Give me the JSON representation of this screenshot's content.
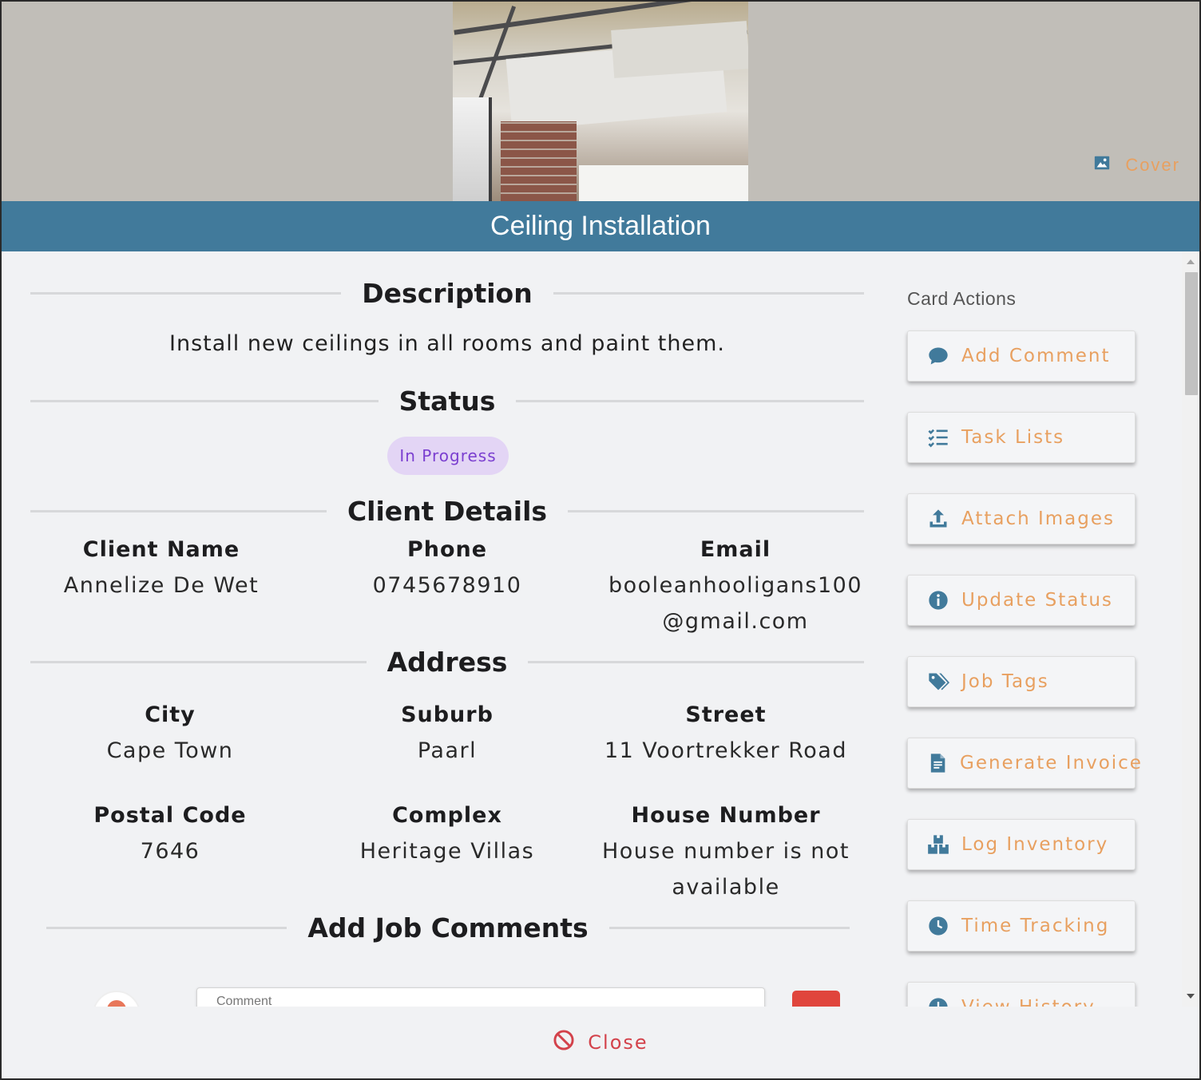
{
  "cover": {
    "button_label": "Cover",
    "button_icon": "image-icon"
  },
  "title": "Ceiling Installation",
  "sections": {
    "description": "Description",
    "status": "Status",
    "client_details": "Client Details",
    "address": "Address",
    "add_comments": "Add Job Comments"
  },
  "description_text": "Install new ceilings in all rooms and paint them.",
  "status_badge": "In Progress",
  "client": {
    "name_label": "Client Name",
    "name_value": "Annelize De Wet",
    "phone_label": "Phone",
    "phone_value": "0745678910",
    "email_label": "Email",
    "email_value_1": "booleanhooligans100",
    "email_value_2": "@gmail.com"
  },
  "address": {
    "city_label": "City",
    "city_value": "Cape Town",
    "suburb_label": "Suburb",
    "suburb_value": "Paarl",
    "street_label": "Street",
    "street_value": "11 Voortrekker Road",
    "postal_label": "Postal Code",
    "postal_value": "7646",
    "complex_label": "Complex",
    "complex_value": "Heritage Villas",
    "house_label": "House Number",
    "house_value_1": "House number is not",
    "house_value_2": "available"
  },
  "comment": {
    "placeholder": "Comment"
  },
  "card_actions": {
    "title": "Card Actions",
    "items": [
      {
        "label": "Add Comment",
        "icon": "comment-icon"
      },
      {
        "label": "Task Lists",
        "icon": "checklist-icon"
      },
      {
        "label": "Attach Images",
        "icon": "upload-icon"
      },
      {
        "label": "Update Status",
        "icon": "info-icon"
      },
      {
        "label": "Job Tags",
        "icon": "tags-icon"
      },
      {
        "label": "Generate Invoice",
        "icon": "invoice-icon"
      },
      {
        "label": "Log Inventory",
        "icon": "boxes-icon"
      },
      {
        "label": "Time Tracking",
        "icon": "clock-icon"
      },
      {
        "label": "View History",
        "icon": "history-icon"
      }
    ]
  },
  "footer": {
    "close_label": "Close"
  },
  "colors": {
    "title_bar": "#417a9b",
    "action_text": "#e8a060",
    "action_icon": "#417a9b",
    "status_badge_bg": "#e3d5f5",
    "status_badge_text": "#7b3fd0",
    "close_text": "#d3424b",
    "comment_clear_button": "#e0453c"
  }
}
